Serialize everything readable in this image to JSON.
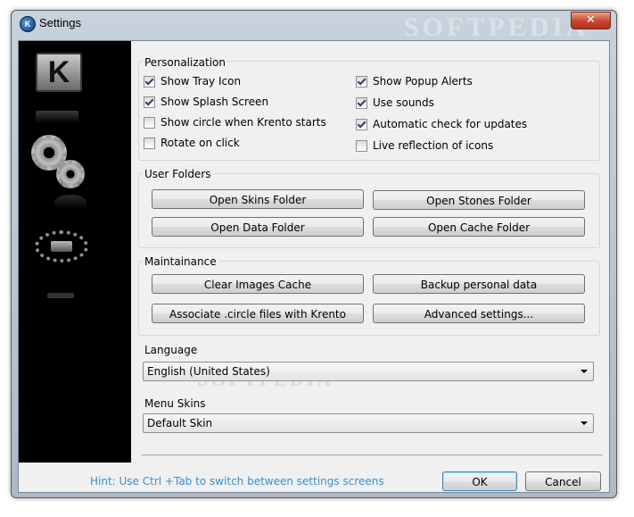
{
  "window": {
    "title": "Settings",
    "close_glyph": "✕",
    "watermark": "SOFTPEDIA",
    "watermark_inner": "SOFTPEDIA"
  },
  "sidebar": {
    "items": [
      {
        "name": "Skins",
        "icon": "krento-k-icon",
        "glyph": "K"
      },
      {
        "name": "Settings",
        "icon": "gears-icon"
      },
      {
        "name": "Circle",
        "icon": "stones-circle-icon"
      }
    ]
  },
  "personalization": {
    "label": "Personalization",
    "options": [
      {
        "label": "Show Tray Icon",
        "checked": true
      },
      {
        "label": "Show Splash Screen",
        "checked": true
      },
      {
        "label": "Show circle when Krento starts",
        "checked": false
      },
      {
        "label": "Rotate on click",
        "checked": false
      },
      {
        "label": "Show Popup Alerts",
        "checked": true
      },
      {
        "label": "Use sounds",
        "checked": true
      },
      {
        "label": "Automatic check for updates",
        "checked": true
      },
      {
        "label": "Live reflection of icons",
        "checked": false
      }
    ]
  },
  "user_folders": {
    "label": "User Folders",
    "buttons": [
      "Open Skins Folder",
      "Open Stones Folder",
      "Open Data Folder",
      "Open Cache Folder"
    ]
  },
  "maintenance": {
    "label": "Maintainance",
    "buttons": [
      "Clear Images Cache",
      "Backup personal data",
      "Associate .circle files with Krento",
      "Advanced settings..."
    ]
  },
  "language": {
    "label": "Language",
    "selected": "English (United States)"
  },
  "menu_skins": {
    "label": "Menu Skins",
    "selected": "Default Skin"
  },
  "footer": {
    "hint": "Hint: Use Ctrl +Tab to switch between settings screens",
    "ok_label": "OK",
    "cancel_label": "Cancel"
  },
  "colors": {
    "hint_text": "#3a8fcf",
    "close_button": "#c7462c",
    "sidebar_bg": "#000000"
  }
}
